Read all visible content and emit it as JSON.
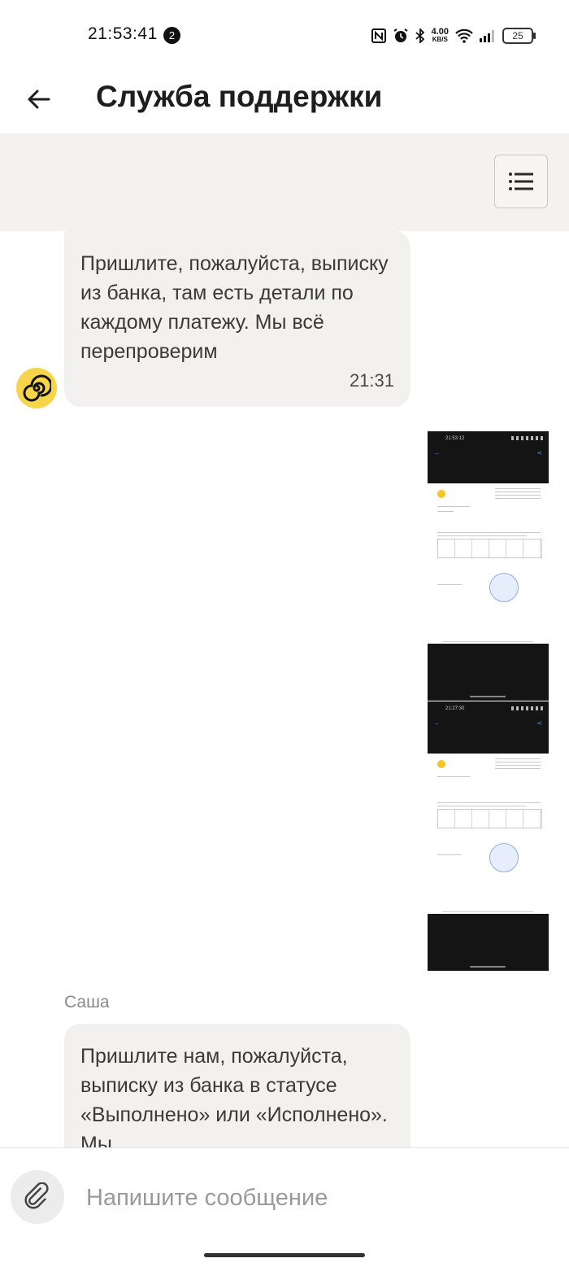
{
  "status_bar": {
    "time": "21:53:41",
    "notification_count": "2",
    "speed_value": "4.00",
    "speed_unit": "KB/S",
    "battery": "25"
  },
  "header": {
    "title": "Служба поддержки"
  },
  "messages": [
    {
      "text": "Пришлите, пожалуйста, выписку из банка, там есть детали по каждому платежу. Мы всё перепроверим",
      "time": "21:31"
    },
    {
      "sender": "Саша",
      "text": "Пришлите нам, пожалуйста, выписку из банка в статусе «Выполнено» или «Исполнено». Мы"
    }
  ],
  "attachments": [
    {
      "time": "21:53:12"
    },
    {
      "time": "21:27:30"
    }
  ],
  "composer": {
    "placeholder": "Напишите сообщение"
  },
  "colors": {
    "avatar": "#f7d54a",
    "bubble": "#f2f1f0",
    "strip": "#f3f2f1"
  }
}
